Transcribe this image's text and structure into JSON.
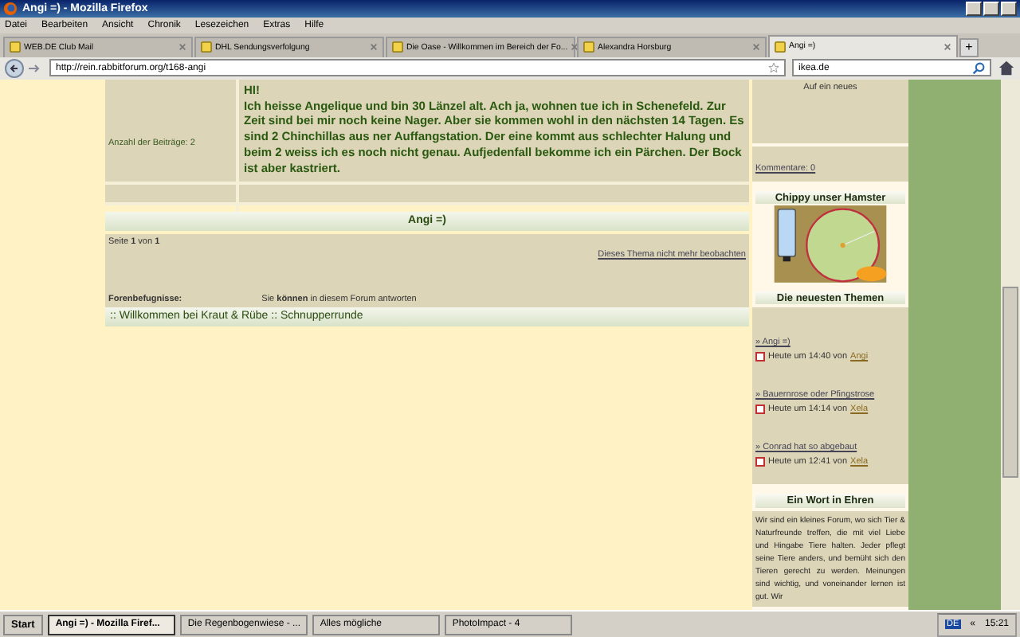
{
  "window": {
    "title": "Angi =) - Mozilla Firefox"
  },
  "menu": [
    "Datei",
    "Bearbeiten",
    "Ansicht",
    "Chronik",
    "Lesezeichen",
    "Extras",
    "Hilfe"
  ],
  "tabs": [
    {
      "label": "WEB.DE Club Mail",
      "selected": false
    },
    {
      "label": "DHL Sendungsverfolgung",
      "selected": false
    },
    {
      "label": "Die Oase - Willkommen im Bereich der Fo...",
      "selected": false
    },
    {
      "label": "Alexandra Horsburg",
      "selected": false
    },
    {
      "label": "Angi =)",
      "selected": true
    }
  ],
  "new_tab": "+",
  "address_bar": {
    "url": "http://rein.rabbitforum.org/t168-angi"
  },
  "search": {
    "value": "ikea.de"
  },
  "post": {
    "author_info": "Anzahl der Beiträge: 2",
    "greeting": "HI!",
    "body": "Ich heisse Angelique und bin 30 Länzel alt. Ach ja, wohnen tue ich in Schenefeld. Zur Zeit sind bei mir noch keine Nager. Aber sie kommen wohl in den nächsten 14 Tagen. Es sind 2 Chinchillas aus ner Auffangstation. Der eine kommt aus schlechter Halung und beim 2 weiss ich es noch nicht genau. Aufjedenfall bekomme ich ein Pärchen. Der Bock ist aber kastriert."
  },
  "topic_title": "Angi =)",
  "pagination": "Seite **1** von **1**",
  "unwatch_link": "Dieses Thema nicht mehr beobachten",
  "permissions": {
    "label": "Forenbefugnisse:",
    "text": "Sie **können** in diesem Forum antworten"
  },
  "breadcrumb": ":: Willkommen bei Kraut & Rübe :: Schnupperrunde",
  "sidebar": {
    "intro": "Auf ein neues",
    "comments": "Kommentare: 0",
    "hamster": {
      "title": "Chippy unser Hamster"
    },
    "latest": {
      "title": "Die neuesten Themen",
      "items": [
        {
          "topic": "» Angi =)",
          "time": "Heute um 14:40 von",
          "user": "Angi"
        },
        {
          "topic": "» Bauernrose oder Pfingstrose",
          "time": "Heute um 14:14 von",
          "user": "Xela"
        },
        {
          "topic": "» Conrad hat so abgebaut",
          "time": "Heute um 12:41 von",
          "user": "Xela"
        }
      ]
    },
    "motto": {
      "title": "Ein Wort in Ehren",
      "text": "Wir sind ein kleines Forum, wo sich Tier & Naturfreunde treffen, die mit viel Liebe und Hingabe Tiere halten. Jeder pflegt seine Tiere anders, und bemüht sich den Tieren gerecht zu werden. Meinungen sind wichtig, und voneinander lernen ist gut. Wir"
    }
  },
  "taskbar": {
    "start": "Start",
    "tasks": [
      {
        "label": "Angi =) - Mozilla Firef...",
        "selected": true
      },
      {
        "label": "Die Regenbogenwiese - ...",
        "selected": false
      },
      {
        "label": "Alles mögliche",
        "selected": false
      },
      {
        "label": "PhotoImpact - 4",
        "selected": false
      }
    ],
    "language": "DE",
    "chevron": "«",
    "clock": "15:21"
  }
}
